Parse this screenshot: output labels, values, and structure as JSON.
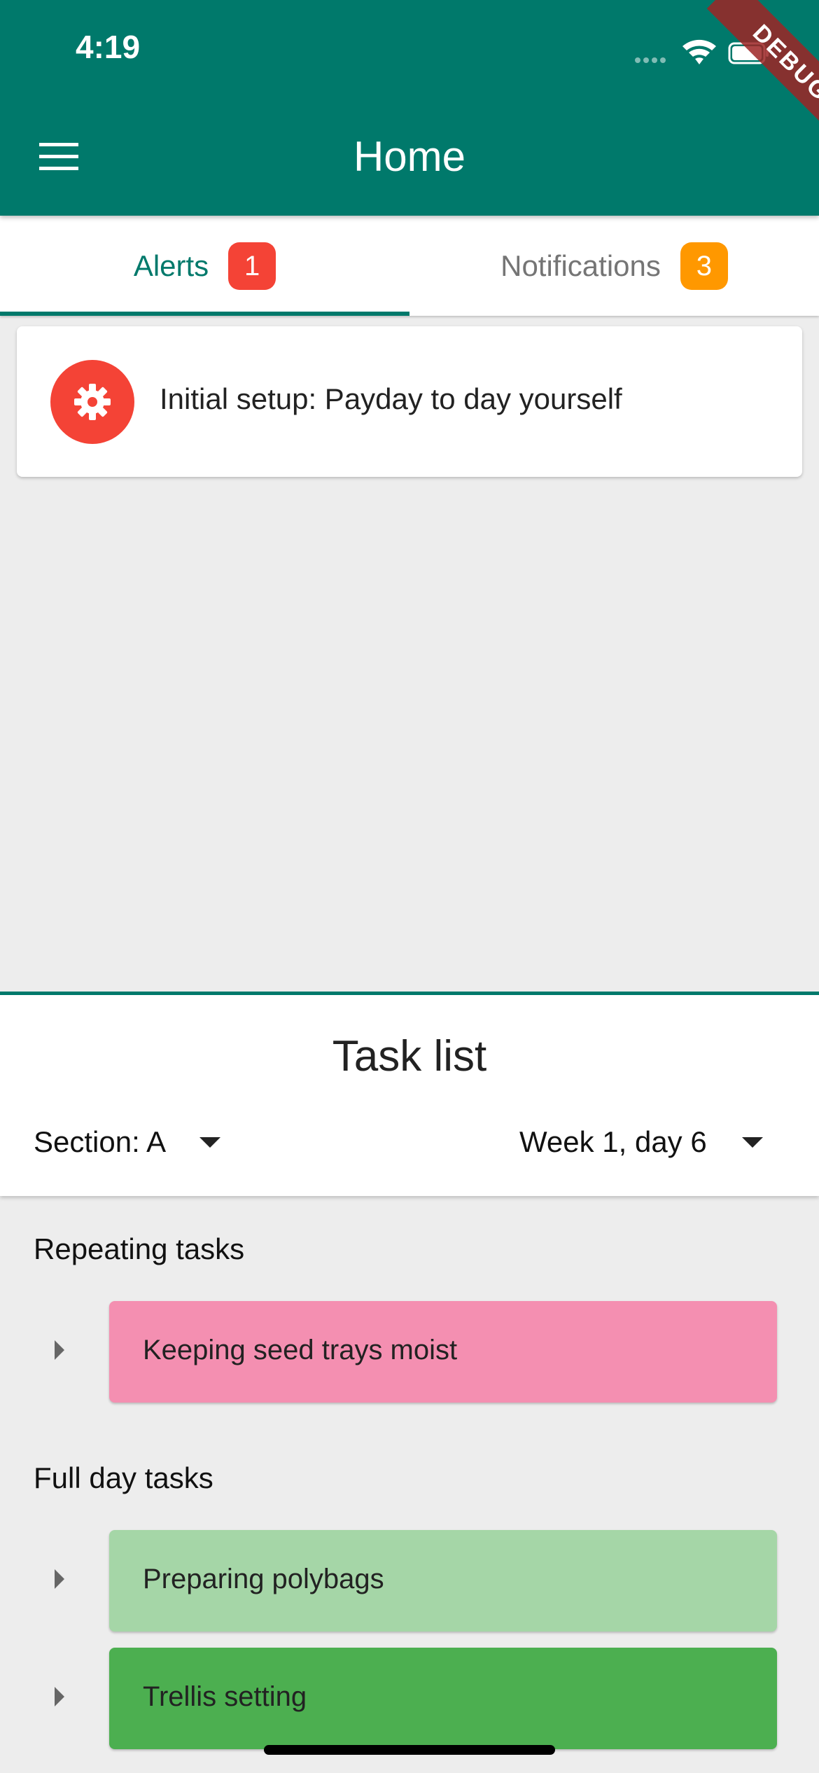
{
  "status_bar": {
    "time": "4:19",
    "icons": [
      "signal-icon",
      "wifi-icon",
      "battery-icon"
    ]
  },
  "debug_banner": "DEBUG",
  "app_bar": {
    "title": "Home",
    "menu_icon": "hamburger-menu-icon",
    "color": "#00796b"
  },
  "tabs": [
    {
      "label": "Alerts",
      "badge": "1",
      "badge_color": "#f44336",
      "selected": true,
      "color": "#00796b"
    },
    {
      "label": "Notifications",
      "badge": "3",
      "badge_color": "#ff9800",
      "selected": false,
      "color": "#757575"
    }
  ],
  "alerts": [
    {
      "icon": "gear-icon",
      "icon_color": "#f44336",
      "text": "Initial setup: Payday to day yourself"
    }
  ],
  "task_list": {
    "title": "Task list",
    "section_dropdown": {
      "value": "Section: A"
    },
    "day_dropdown": {
      "value": "Week 1, day 6"
    },
    "groups": [
      {
        "title": "Repeating tasks",
        "tasks": [
          {
            "label": "Keeping seed trays moist",
            "color": "#f48fb1"
          }
        ]
      },
      {
        "title": "Full day tasks",
        "tasks": [
          {
            "label": "Preparing polybags",
            "color": "#a5d6a7"
          },
          {
            "label": "Trellis setting",
            "color": "#4caf50"
          }
        ]
      }
    ]
  }
}
